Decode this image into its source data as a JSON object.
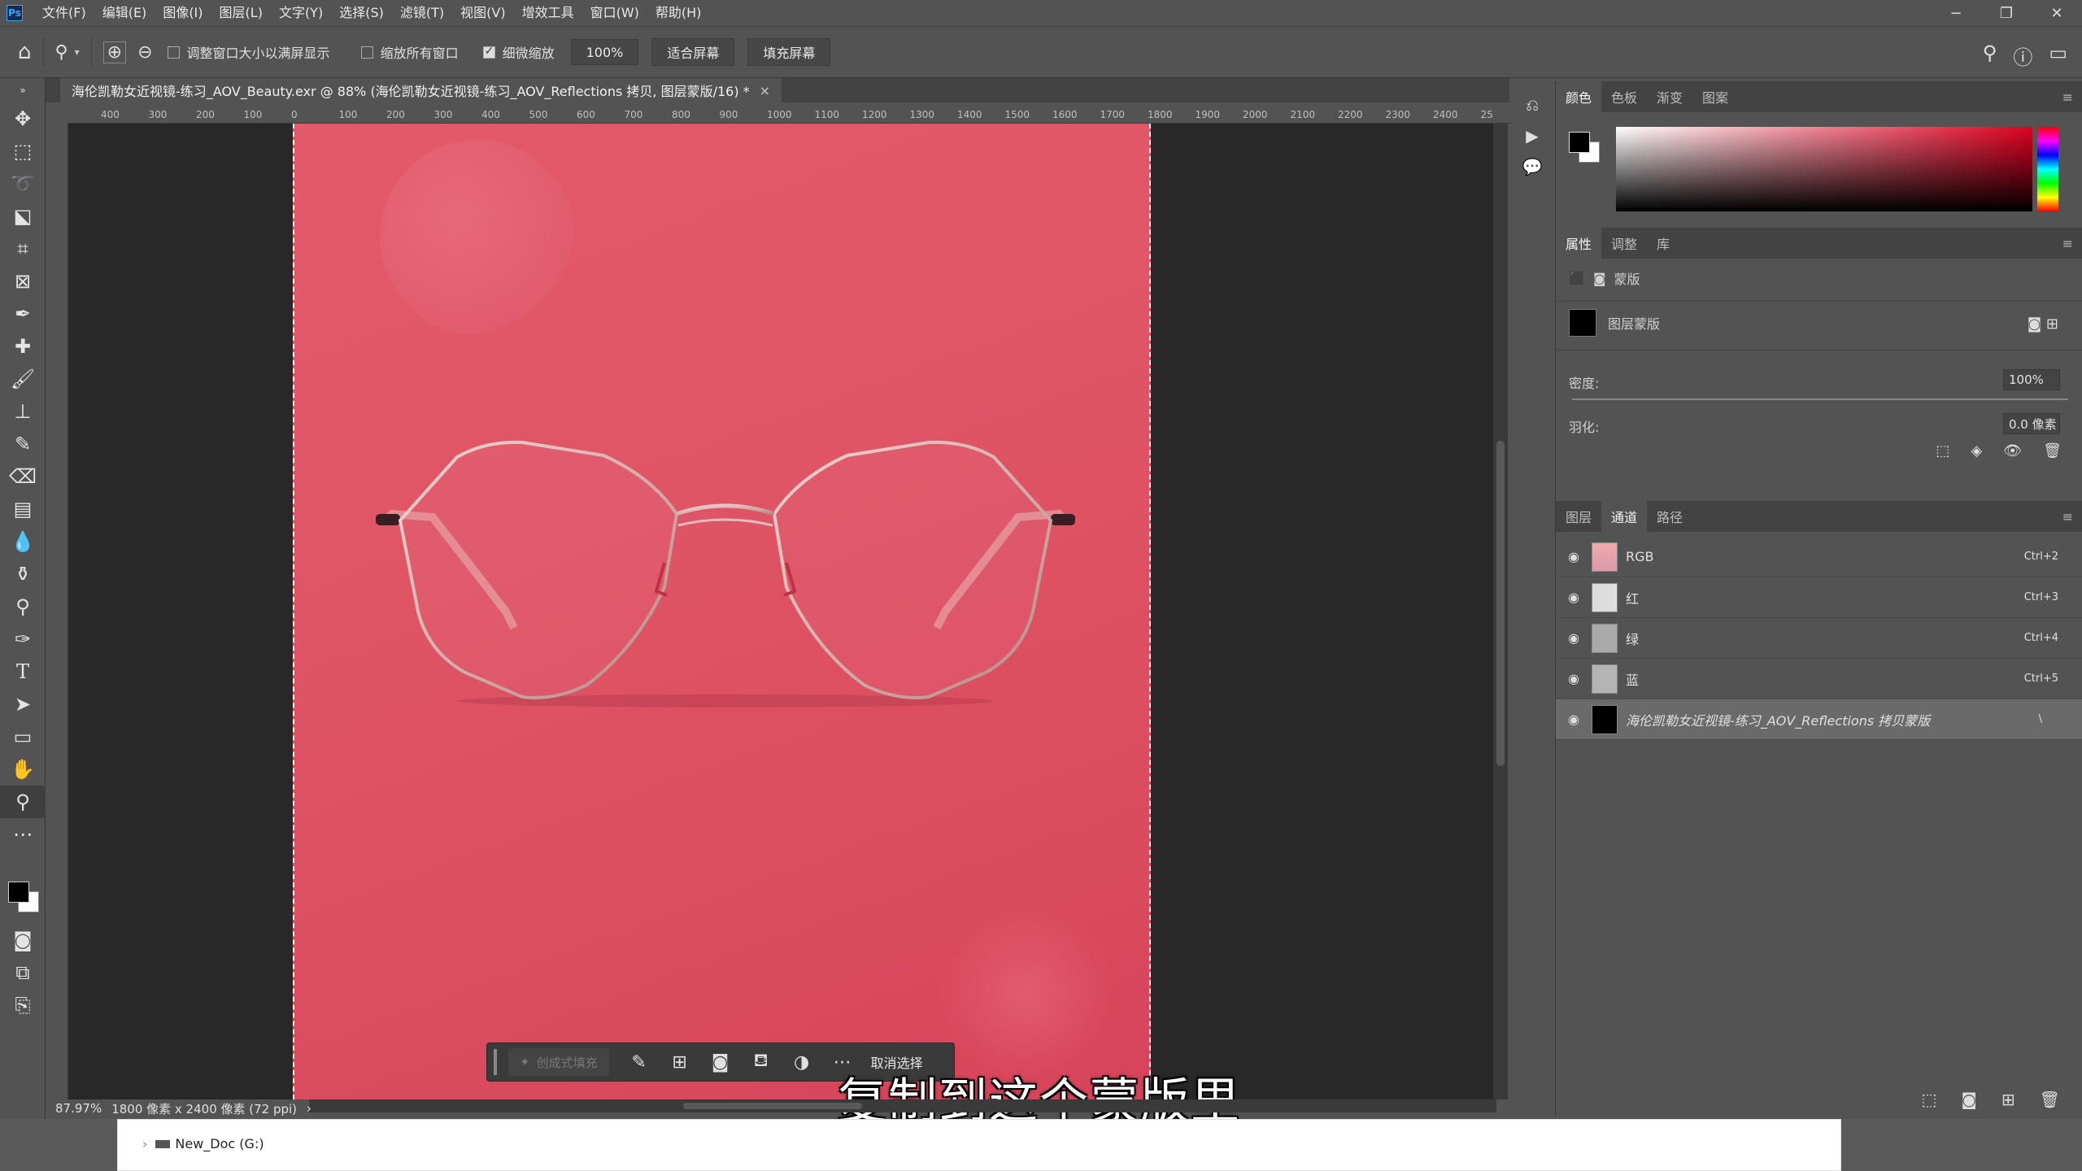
{
  "menubar": {
    "logo": "Ps",
    "items": [
      "文件(F)",
      "编辑(E)",
      "图像(I)",
      "图层(L)",
      "文字(Y)",
      "选择(S)",
      "滤镜(T)",
      "视图(V)",
      "增效工具",
      "窗口(W)",
      "帮助(H)"
    ]
  },
  "options": {
    "resize_windows_label": "调整窗口大小以满屏显示",
    "zoom_all_label": "缩放所有窗口",
    "scrubby_zoom_label": "细微缩放",
    "zoom_value": "100%",
    "fit_screen": "适合屏幕",
    "fill_screen": "填充屏幕"
  },
  "document": {
    "tab_title": "海伦凯勒女近视镜-练习_AOV_Beauty.exr @ 88% (海伦凯勒女近视镜-练习_AOV_Reflections 拷贝, 图层蒙版/16) *",
    "tab_close": "×",
    "ruler_labels": [
      "400",
      "300",
      "200",
      "100",
      "0",
      "100",
      "200",
      "300",
      "400",
      "500",
      "600",
      "700",
      "800",
      "900",
      "1000",
      "1100",
      "1200",
      "1300",
      "1400",
      "1500",
      "1600",
      "1700",
      "1800",
      "1900",
      "2000",
      "2100",
      "2200",
      "2300",
      "2400",
      "25"
    ]
  },
  "taskbar": {
    "generative_fill": "创成式填充",
    "deselect": "取消选择"
  },
  "subtitle": "复制到这个蒙版里",
  "status": {
    "zoom": "87.97%",
    "dimensions": "1800 像素 x 2400 像素 (72 ppi)"
  },
  "color_panel": {
    "tabs": [
      "颜色",
      "色板",
      "渐变",
      "图案"
    ],
    "fg_color": "#000000",
    "bg_color": "#ffffff"
  },
  "properties_panel": {
    "tabs": [
      "属性",
      "调整",
      "库"
    ],
    "mask_section": "蒙版",
    "layer_mask_label": "图层蒙版",
    "density_label": "密度:",
    "density_value": "100%",
    "feather_label": "羽化:",
    "feather_value": "0.0 像素"
  },
  "channels_panel": {
    "tabs": [
      "图层",
      "通道",
      "路径"
    ],
    "channels": [
      {
        "name": "RGB",
        "shortcut": "Ctrl+2"
      },
      {
        "name": "红",
        "shortcut": "Ctrl+3"
      },
      {
        "name": "绿",
        "shortcut": "Ctrl+4"
      },
      {
        "name": "蓝",
        "shortcut": "Ctrl+5"
      },
      {
        "name": "海伦凯勒女近视镜-练习_AOV_Reflections 拷贝蒙版",
        "shortcut": "\\"
      }
    ]
  },
  "explorer": {
    "drive_label": "New_Doc (G:)"
  }
}
